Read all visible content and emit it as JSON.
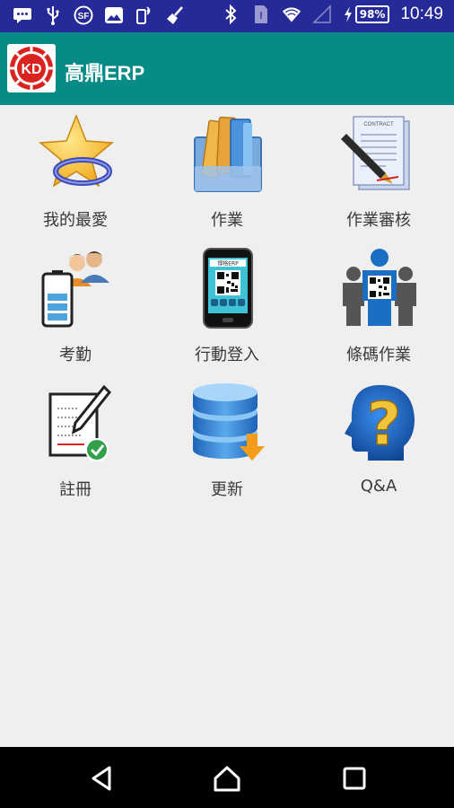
{
  "status_bar": {
    "left_icons": [
      "chat-icon",
      "usb-icon",
      "sf-icon",
      "image-icon",
      "phone-icon",
      "broom-icon"
    ],
    "right_icons": [
      "bluetooth-icon",
      "sim-icon",
      "wifi-icon",
      "signal-icon"
    ],
    "battery": "98%",
    "time": "10:49"
  },
  "app_bar": {
    "logo_text": "KD",
    "title": "高鼎ERP"
  },
  "menu": {
    "items": [
      {
        "label": "我的最愛",
        "icon": "favorite-star-icon"
      },
      {
        "label": "作業",
        "icon": "folders-icon"
      },
      {
        "label": "作業審核",
        "icon": "contract-pen-icon"
      },
      {
        "label": "考勤",
        "icon": "attendance-people-icon"
      },
      {
        "label": "行動登入",
        "icon": "phone-qr-icon"
      },
      {
        "label": "條碼作業",
        "icon": "barcode-people-icon"
      },
      {
        "label": "註冊",
        "icon": "register-check-icon"
      },
      {
        "label": "更新",
        "icon": "database-update-icon"
      },
      {
        "label": "Q&A",
        "icon": "question-head-icon"
      }
    ]
  },
  "nav_bar": {
    "buttons": [
      "back-icon",
      "home-icon",
      "recents-icon"
    ]
  },
  "colors": {
    "status_bar": "#262a98",
    "app_bar": "#068b86",
    "background": "#efefef",
    "nav_bar": "#000000"
  }
}
